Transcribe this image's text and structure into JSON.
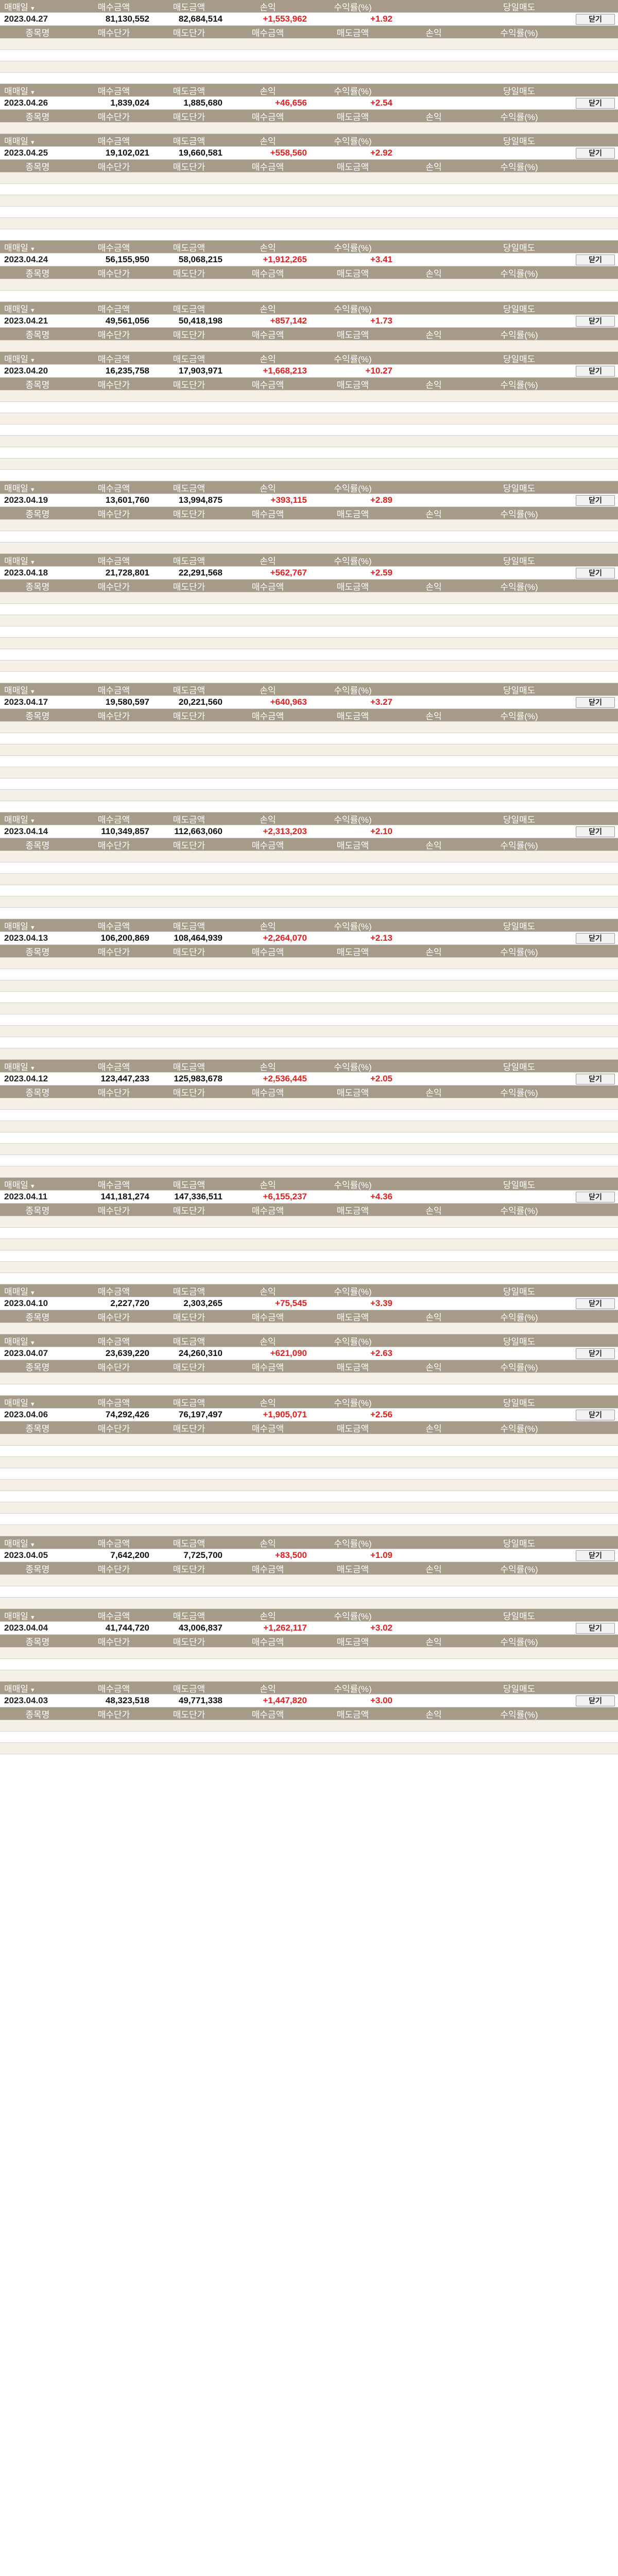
{
  "labels": {
    "trade_type": "매매일",
    "buy_amount": "매수금액",
    "sell_amount": "매도금액",
    "pnl": "손익",
    "return_rate": "수익률(%)",
    "daily_trade": "당일매도",
    "close_button": "닫기",
    "stock_name": "종목명",
    "buy_price": "매수단가",
    "sell_price": "매도단가"
  },
  "colors": {
    "header_bg": "#a69a88",
    "row_tint": "#f4f0e6",
    "positive": "#e02020",
    "negative": "#1a3fd0"
  },
  "days": [
    {
      "date": "2023.04.27",
      "buy_amount": "81,130,552",
      "sell_amount": "82,684,514",
      "pnl": "+1,553,962",
      "return_rate": "+1.92",
      "sign": "pos",
      "trade_rows": 4
    },
    {
      "date": "2023.04.26",
      "buy_amount": "1,839,024",
      "sell_amount": "1,885,680",
      "pnl": "+46,656",
      "return_rate": "+2.54",
      "sign": "pos",
      "trade_rows": 1
    },
    {
      "date": "2023.04.25",
      "buy_amount": "19,102,021",
      "sell_amount": "19,660,581",
      "pnl": "+558,560",
      "return_rate": "+2.92",
      "sign": "pos",
      "trade_rows": 6
    },
    {
      "date": "2023.04.24",
      "buy_amount": "56,155,950",
      "sell_amount": "58,068,215",
      "pnl": "+1,912,265",
      "return_rate": "+3.41",
      "sign": "pos",
      "trade_rows": 2
    },
    {
      "date": "2023.04.21",
      "buy_amount": "49,561,056",
      "sell_amount": "50,418,198",
      "pnl": "+857,142",
      "return_rate": "+1.73",
      "sign": "pos",
      "trade_rows": 1
    },
    {
      "date": "2023.04.20",
      "buy_amount": "16,235,758",
      "sell_amount": "17,903,971",
      "pnl": "+1,668,213",
      "return_rate": "+10.27",
      "sign": "pos",
      "trade_rows": 8
    },
    {
      "date": "2023.04.19",
      "buy_amount": "13,601,760",
      "sell_amount": "13,994,875",
      "pnl": "+393,115",
      "return_rate": "+2.89",
      "sign": "pos",
      "trade_rows": 3
    },
    {
      "date": "2023.04.18",
      "buy_amount": "21,728,801",
      "sell_amount": "22,291,568",
      "pnl": "+562,767",
      "return_rate": "+2.59",
      "sign": "pos",
      "trade_rows": 8
    },
    {
      "date": "2023.04.17",
      "buy_amount": "19,580,597",
      "sell_amount": "20,221,560",
      "pnl": "+640,963",
      "return_rate": "+3.27",
      "sign": "pos",
      "trade_rows": 8
    },
    {
      "date": "2023.04.14",
      "buy_amount": "110,349,857",
      "sell_amount": "112,663,060",
      "pnl": "+2,313,203",
      "return_rate": "+2.10",
      "sign": "pos",
      "trade_rows": 6
    },
    {
      "date": "2023.04.13",
      "buy_amount": "106,200,869",
      "sell_amount": "108,464,939",
      "pnl": "+2,264,070",
      "return_rate": "+2.13",
      "sign": "pos",
      "trade_rows": 9
    },
    {
      "date": "2023.04.12",
      "buy_amount": "123,447,233",
      "sell_amount": "125,983,678",
      "pnl": "+2,536,445",
      "return_rate": "+2.05",
      "sign": "pos",
      "trade_rows": 7
    },
    {
      "date": "2023.04.11",
      "buy_amount": "141,181,274",
      "sell_amount": "147,336,511",
      "pnl": "+6,155,237",
      "return_rate": "+4.36",
      "sign": "pos",
      "trade_rows": 6
    },
    {
      "date": "2023.04.10",
      "buy_amount": "2,227,720",
      "sell_amount": "2,303,265",
      "pnl": "+75,545",
      "return_rate": "+3.39",
      "sign": "pos",
      "trade_rows": 1
    },
    {
      "date": "2023.04.07",
      "buy_amount": "23,639,220",
      "sell_amount": "24,260,310",
      "pnl": "+621,090",
      "return_rate": "+2.63",
      "sign": "pos",
      "trade_rows": 2
    },
    {
      "date": "2023.04.06",
      "buy_amount": "74,292,426",
      "sell_amount": "76,197,497",
      "pnl": "+1,905,071",
      "return_rate": "+2.56",
      "sign": "pos",
      "trade_rows": 9
    },
    {
      "date": "2023.04.05",
      "buy_amount": "7,642,200",
      "sell_amount": "7,725,700",
      "pnl": "+83,500",
      "return_rate": "+1.09",
      "sign": "pos",
      "trade_rows": 3
    },
    {
      "date": "2023.04.04",
      "buy_amount": "41,744,720",
      "sell_amount": "43,006,837",
      "pnl": "+1,262,117",
      "return_rate": "+3.02",
      "sign": "pos",
      "trade_rows": 3
    },
    {
      "date": "2023.04.03",
      "buy_amount": "48,323,518",
      "sell_amount": "49,771,338",
      "pnl": "+1,447,820",
      "return_rate": "+3.00",
      "sign": "pos",
      "trade_rows": 3
    }
  ]
}
